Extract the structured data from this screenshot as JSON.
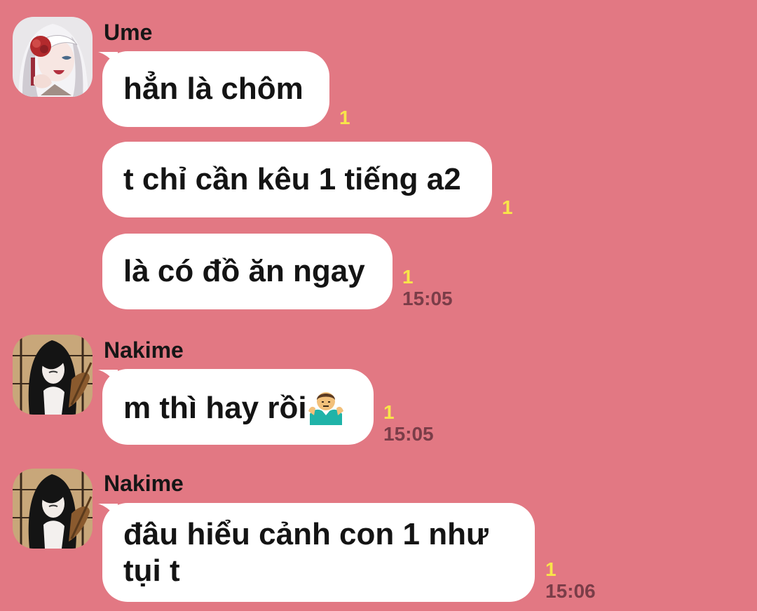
{
  "colors": {
    "background": "#e27883",
    "bubble": "#ffffff",
    "read_count": "#f8e54a",
    "timestamp": "#7a3d48"
  },
  "groups": [
    {
      "sender": "Ume",
      "avatar_icon": "ume-avatar-icon",
      "messages": [
        {
          "text": "hẳn là chôm",
          "read": "1"
        },
        {
          "text": "t chỉ cần kêu 1 tiếng a2",
          "read": "1"
        },
        {
          "text": "là có đồ ăn ngay",
          "read": "1",
          "time": "15:05"
        }
      ]
    },
    {
      "sender": "Nakime",
      "avatar_icon": "nakime-avatar-icon",
      "messages": [
        {
          "text": "m thì hay rồi",
          "emoji": "person-shrugging-icon",
          "read": "1",
          "time": "15:05"
        }
      ]
    },
    {
      "sender": "Nakime",
      "avatar_icon": "nakime-avatar-icon",
      "messages": [
        {
          "text": "đâu hiểu cảnh con 1 như tụi t",
          "read": "1",
          "time": "15:06"
        }
      ]
    }
  ]
}
